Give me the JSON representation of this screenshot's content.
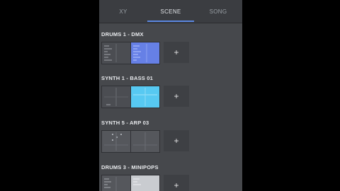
{
  "tabs": [
    {
      "label": "XY",
      "active": false
    },
    {
      "label": "SCENE",
      "active": true
    },
    {
      "label": "SONG",
      "active": false
    }
  ],
  "tracks": [
    {
      "name": "DRUMS 1 - DMX",
      "clips": [
        {
          "color": "#4b4d52",
          "selected": false
        },
        {
          "color": "#6680e6",
          "selected": true
        }
      ]
    },
    {
      "name": "SYNTH 1 - BASS 01",
      "clips": [
        {
          "color": "#4b4d52",
          "selected": false
        },
        {
          "color": "#57c9f2",
          "selected": true
        }
      ]
    },
    {
      "name": "SYNTH 5 - ARP 03",
      "clips": [
        {
          "color": "#55575c",
          "selected": false
        },
        {
          "color": "#55575c",
          "selected": false
        }
      ]
    },
    {
      "name": "DRUMS 3 - MINIPOPS",
      "clips": [
        {
          "color": "#55575c",
          "selected": false
        },
        {
          "color": "#c9ccd0",
          "selected": true
        }
      ]
    }
  ],
  "add_clip_label": "+",
  "colors": {
    "panel": "#46484c",
    "tabbar": "#3b3d41",
    "accent": "#5a86e0"
  }
}
